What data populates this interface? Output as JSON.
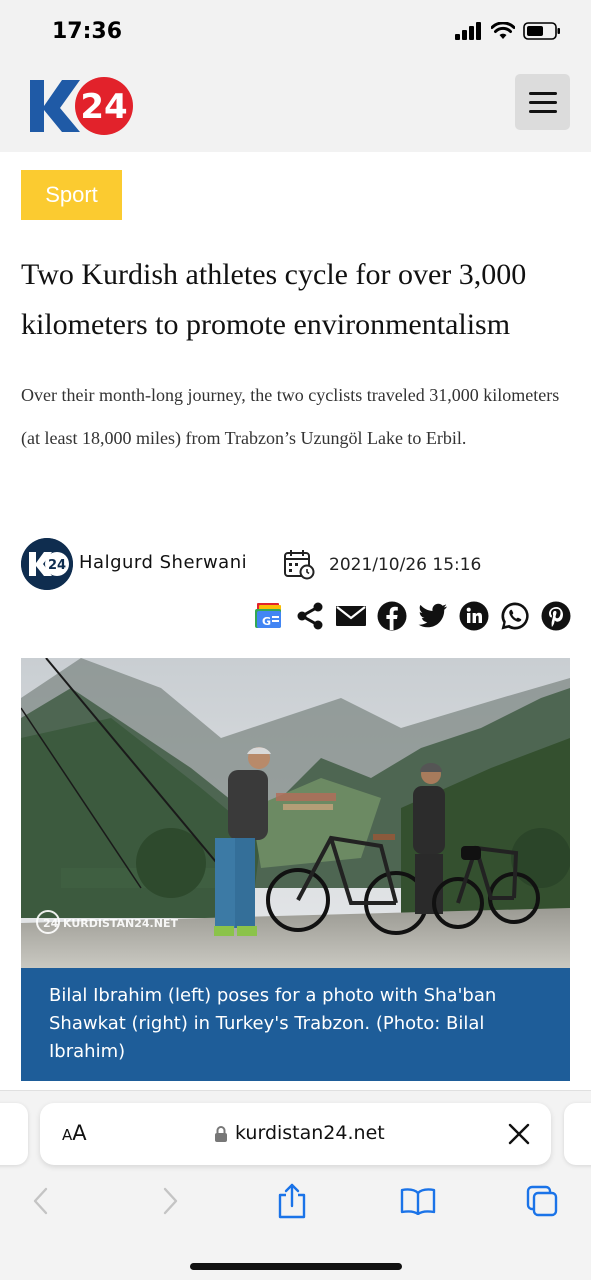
{
  "status_bar": {
    "time": "17:36"
  },
  "header": {
    "logo_text": "K24",
    "menu_icon": "hamburger-menu-icon"
  },
  "article": {
    "category": "Sport",
    "headline": "Two Kurdish athletes cycle for over 3,000 kilometers to promote environmentalism",
    "summary": "Over their month-long journey, the two cyclists traveled 31,000 kilometers (at least 18,000 miles) from Trabzon’s Uzungöl Lake to Erbil.",
    "author": "Halgurd Sherwani",
    "published": "2021/10/26 15:16",
    "photo_watermark": "KURDISTAN24.NET",
    "caption": "Bilal Ibrahim (left) poses for a photo with Sha'ban Shawkat (right) in Turkey's Trabzon. (Photo: Bilal Ibrahim)"
  },
  "share_icons": [
    "google-news-icon",
    "share-icon",
    "email-icon",
    "facebook-icon",
    "twitter-icon",
    "linkedin-icon",
    "whatsapp-icon",
    "pinterest-icon"
  ],
  "browser": {
    "reader_label_small": "A",
    "reader_label_big": "A",
    "url": "kurdistan24.net"
  },
  "colors": {
    "category_bg": "#fbcb30",
    "caption_bg": "#1e5d99",
    "logo_blue": "#1f5aa6",
    "logo_red": "#e2222b",
    "ios_blue": "#1a73e8"
  }
}
